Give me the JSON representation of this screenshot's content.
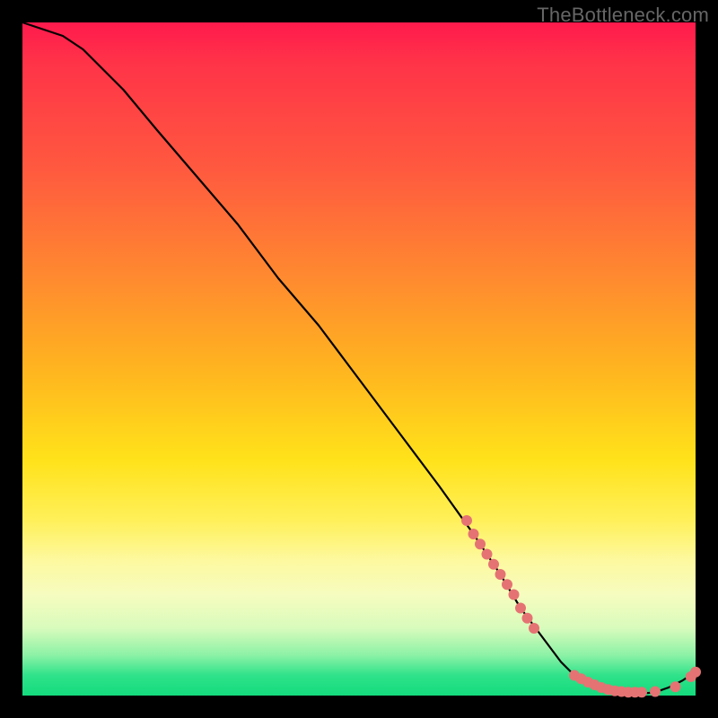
{
  "watermark": "TheBottleneck.com",
  "colors": {
    "background": "#000000",
    "curve_stroke": "#000000",
    "point_fill": "#e57373",
    "gradient_top": "#ff1a4d",
    "gradient_mid": "#ffe21a",
    "gradient_bottom": "#14db7d"
  },
  "chart_data": {
    "type": "line",
    "title": "",
    "xlabel": "",
    "ylabel": "",
    "xlim": [
      0,
      100
    ],
    "ylim": [
      0,
      100
    ],
    "series": [
      {
        "name": "bottleneck-curve",
        "x": [
          0,
          3,
          6,
          9,
          12,
          15,
          20,
          26,
          32,
          38,
          44,
          50,
          56,
          62,
          67,
          71,
          74,
          77,
          80,
          82,
          84,
          86,
          88,
          90,
          92,
          94,
          96,
          98,
          100
        ],
        "y": [
          100,
          99,
          98,
          96,
          93,
          90,
          84,
          77,
          70,
          62,
          55,
          47,
          39,
          31,
          24,
          18,
          13,
          9,
          5,
          3,
          2,
          1,
          0.5,
          0.3,
          0.3,
          0.5,
          1.2,
          2.2,
          3.5
        ]
      }
    ],
    "points": {
      "name": "highlighted-points",
      "comment": "salmon dots clustered on the descending slope (~x 66–76) and along the flat bottom (~x 82–97), plus a pair near x≈100",
      "x": [
        66,
        67,
        68,
        69,
        70,
        71,
        72,
        73,
        74,
        75,
        76,
        82,
        83,
        84,
        85,
        86,
        87,
        88,
        89,
        90,
        91,
        92,
        94,
        97,
        99.3,
        100
      ],
      "y": [
        26,
        24,
        22.5,
        21,
        19.5,
        18,
        16.5,
        15,
        13,
        11.5,
        10,
        3,
        2.5,
        2,
        1.6,
        1.2,
        0.9,
        0.7,
        0.6,
        0.5,
        0.5,
        0.5,
        0.6,
        1.3,
        2.8,
        3.5
      ]
    }
  }
}
